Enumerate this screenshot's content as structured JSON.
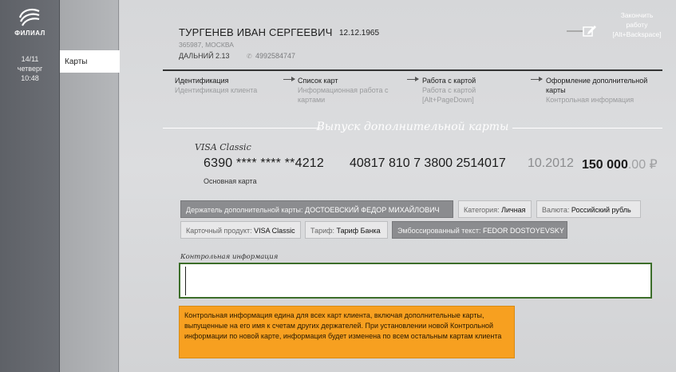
{
  "sidebar": {
    "logo_text": "ФИЛИАЛ",
    "date": "14/11",
    "weekday": "четверг",
    "time": "10:48",
    "nav_active": "Карты"
  },
  "client": {
    "name": "ТУРГЕНЕВ ИВАН СЕРГЕЕВИЧ",
    "birth_date": "12.12.1965",
    "address": "365987, МОСКВА",
    "branch": "ДАЛЬНИЙ 2.13",
    "phone": "4992584747"
  },
  "finish": {
    "line1": "Закончить",
    "line2": "работу",
    "line3": "[Alt+Backspace]"
  },
  "steps": [
    {
      "title": "Идентификация",
      "sub": "Идентификация клиента"
    },
    {
      "title": "Список карт",
      "sub": "Информационная работа с картами"
    },
    {
      "title": "Работа с картой",
      "sub": "Работа с картой [Alt+PageDown]"
    },
    {
      "title": "Оформление дополнительной карты",
      "sub": "Контрольная информация"
    }
  ],
  "section_title": "Выпуск дополнительной карты",
  "card": {
    "type": "VISA Classic",
    "number": "6390 **** **** **4212",
    "account": "40817 810 7 3800 2514017",
    "expiry": "10.2012",
    "amount_int": "150 000",
    "amount_dec": ".00 ₽",
    "note": "Основная карта"
  },
  "tags": {
    "holder_label": "Держатель дополнительной карты: ",
    "holder_value": "ДОСТОЕВСКИЙ ФЕДОР МИХАЙЛОВИЧ",
    "category_label": "Категория: ",
    "category_value": "Личная",
    "currency_label": "Валюта: ",
    "currency_value": "Российский рубль",
    "product_label": "Карточный продукт: ",
    "product_value": "VISA Classic",
    "tariff_label": "Тариф: ",
    "tariff_value": "Тариф Банка",
    "emboss_label": "Эмбоссированный текст: ",
    "emboss_value": "FEDOR DOSTOYEVSKY"
  },
  "control": {
    "label": "Контрольная информация",
    "value": ""
  },
  "warning": "Контрольная информация едина для всех карт клиента, включая дополнительные карты, выпущенные на его имя к счетам других держателей. При установлении новой Контрольной информации по новой карте, информация будет изменена по всем остальным картам клиента",
  "colors": {
    "accent_orange": "#f7a020",
    "input_border": "#3c6e2a",
    "sidebar_dark": "#5e6167"
  }
}
